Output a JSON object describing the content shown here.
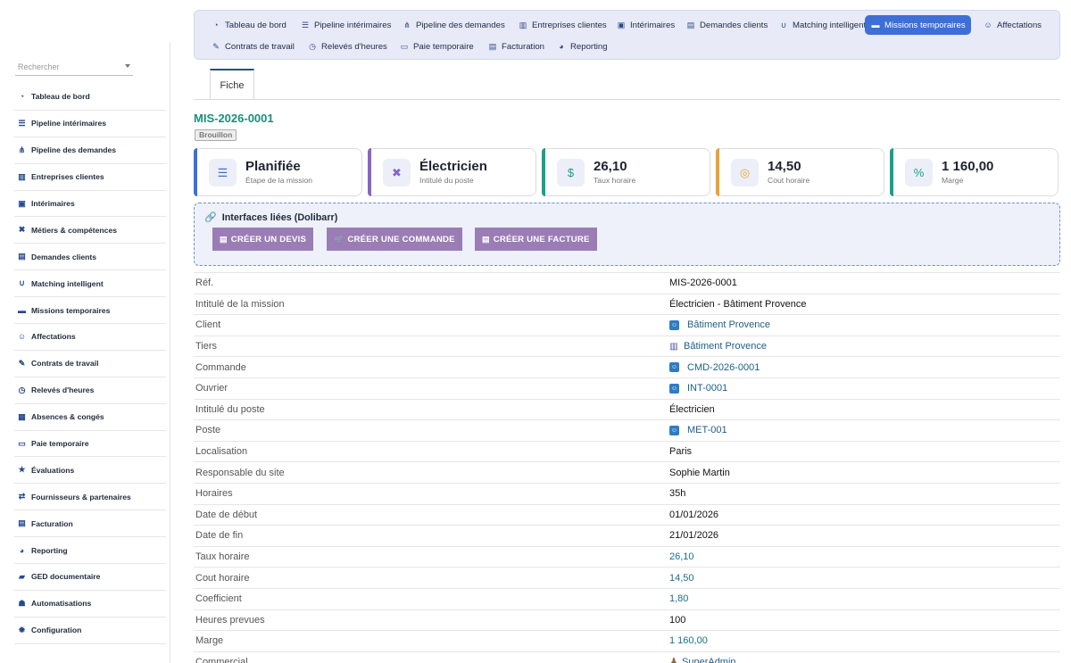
{
  "search": {
    "placeholder": "Rechercher"
  },
  "sidebar": {
    "items": [
      {
        "label": "Tableau de bord",
        "icon": "dashboard-icon"
      },
      {
        "label": "Pipeline intérimaires",
        "icon": "list-icon"
      },
      {
        "label": "Pipeline des demandes",
        "icon": "flow-icon"
      },
      {
        "label": "Entreprises clientes",
        "icon": "building-icon"
      },
      {
        "label": "Intérimaires",
        "icon": "id-card-icon"
      },
      {
        "label": "Métiers & compétences",
        "icon": "tools-icon"
      },
      {
        "label": "Demandes clients",
        "icon": "clipboard-icon"
      },
      {
        "label": "Matching intelligent",
        "icon": "magnet-icon"
      },
      {
        "label": "Missions temporaires",
        "icon": "briefcase-icon"
      },
      {
        "label": "Affectations",
        "icon": "user-plus-icon"
      },
      {
        "label": "Contrats de travail",
        "icon": "contract-icon"
      },
      {
        "label": "Relevés d'heures",
        "icon": "clock-icon"
      },
      {
        "label": "Absences & congés",
        "icon": "calendar-icon"
      },
      {
        "label": "Paie temporaire",
        "icon": "payroll-icon"
      },
      {
        "label": "Évaluations",
        "icon": "star-icon"
      },
      {
        "label": "Fournisseurs & partenaires",
        "icon": "handshake-icon"
      },
      {
        "label": "Facturation",
        "icon": "invoice-icon"
      },
      {
        "label": "Reporting",
        "icon": "pie-chart-icon"
      },
      {
        "label": "GED documentaire",
        "icon": "folder-icon"
      },
      {
        "label": "Automatisations",
        "icon": "robot-icon"
      },
      {
        "label": "Configuration",
        "icon": "gear-icon"
      }
    ]
  },
  "topnav": {
    "items": [
      {
        "label": "Tableau de bord",
        "icon": "dashboard-icon"
      },
      {
        "label": "Pipeline intérimaires",
        "icon": "list-icon"
      },
      {
        "label": "Pipeline des demandes",
        "icon": "flow-icon"
      },
      {
        "label": "Entreprises clientes",
        "icon": "building-icon"
      },
      {
        "label": "Intérimaires",
        "icon": "id-card-icon"
      },
      {
        "label": "Demandes clients",
        "icon": "clipboard-icon"
      },
      {
        "label": "Matching intelligent",
        "icon": "magnet-icon"
      },
      {
        "label": "Missions temporaires",
        "icon": "briefcase-icon",
        "active": true
      },
      {
        "label": "Affectations",
        "icon": "user-plus-icon"
      },
      {
        "label": "Contrats de travail",
        "icon": "contract-icon"
      },
      {
        "label": "Relevés d'heures",
        "icon": "clock-icon"
      },
      {
        "label": "Paie temporaire",
        "icon": "payroll-icon"
      },
      {
        "label": "Facturation",
        "icon": "invoice-icon"
      },
      {
        "label": "Reporting",
        "icon": "pie-chart-icon"
      }
    ]
  },
  "tabs": {
    "fiche": "Fiche"
  },
  "record": {
    "ref": "MIS-2026-0001",
    "status": "Brouillon"
  },
  "cards": [
    {
      "value": "Planifiée",
      "label": "Étape de la mission",
      "icon": "list-icon",
      "color": "#3d6fd6"
    },
    {
      "value": "Électricien",
      "label": "Intitulé du poste",
      "icon": "tools-icon",
      "color": "#8a63c9"
    },
    {
      "value": "26,10",
      "label": "Taux horaire",
      "icon": "money-doc-icon",
      "color": "#1aa08a"
    },
    {
      "value": "14,50",
      "label": "Cout horaire",
      "icon": "coins-icon",
      "color": "#e9a33a"
    },
    {
      "value": "1 160,00",
      "label": "Marge",
      "icon": "percent-icon",
      "color": "#1aa08a"
    }
  ],
  "linked": {
    "title": "Interfaces liées (Dolibarr)",
    "buttons": [
      "CRÉER UN DEVIS",
      "CRÉER UNE COMMANDE",
      "CRÉER UNE FACTURE"
    ]
  },
  "fields": [
    {
      "key": "Réf.",
      "value": "MIS-2026-0001"
    },
    {
      "key": "Intitulé de la mission",
      "value": "Électricien - Bâtiment Provence"
    },
    {
      "key": "Client",
      "value": "Bâtiment Provence",
      "link": true,
      "icon": "contact-icon"
    },
    {
      "key": "Tiers",
      "value": "Bâtiment Provence",
      "link": true,
      "icon": "building-icon"
    },
    {
      "key": "Commande",
      "value": "CMD-2026-0001",
      "link": true,
      "icon": "contact-icon"
    },
    {
      "key": "Ouvrier",
      "value": "INT-0001",
      "link": true,
      "icon": "contact-icon"
    },
    {
      "key": "Intitulé du poste",
      "value": "Électricien"
    },
    {
      "key": "Poste",
      "value": "MET-001",
      "link": true,
      "icon": "contact-icon"
    },
    {
      "key": "Localisation",
      "value": "Paris"
    },
    {
      "key": "Responsable du site",
      "value": "Sophie Martin"
    },
    {
      "key": "Horaires",
      "value": "35h"
    },
    {
      "key": "Date de début",
      "value": "01/01/2026"
    },
    {
      "key": "Date de fin",
      "value": "21/01/2026"
    },
    {
      "key": "Taux horaire",
      "value": "26,10",
      "num": true
    },
    {
      "key": "Cout horaire",
      "value": "14,50",
      "num": true
    },
    {
      "key": "Coefficient",
      "value": "1,80",
      "num": true
    },
    {
      "key": "Heures prevues",
      "value": "100"
    },
    {
      "key": "Marge",
      "value": "1 160,00",
      "num": true
    },
    {
      "key": "Commercial",
      "value": "SuperAdmin",
      "link": true,
      "icon": "user-icon"
    }
  ]
}
